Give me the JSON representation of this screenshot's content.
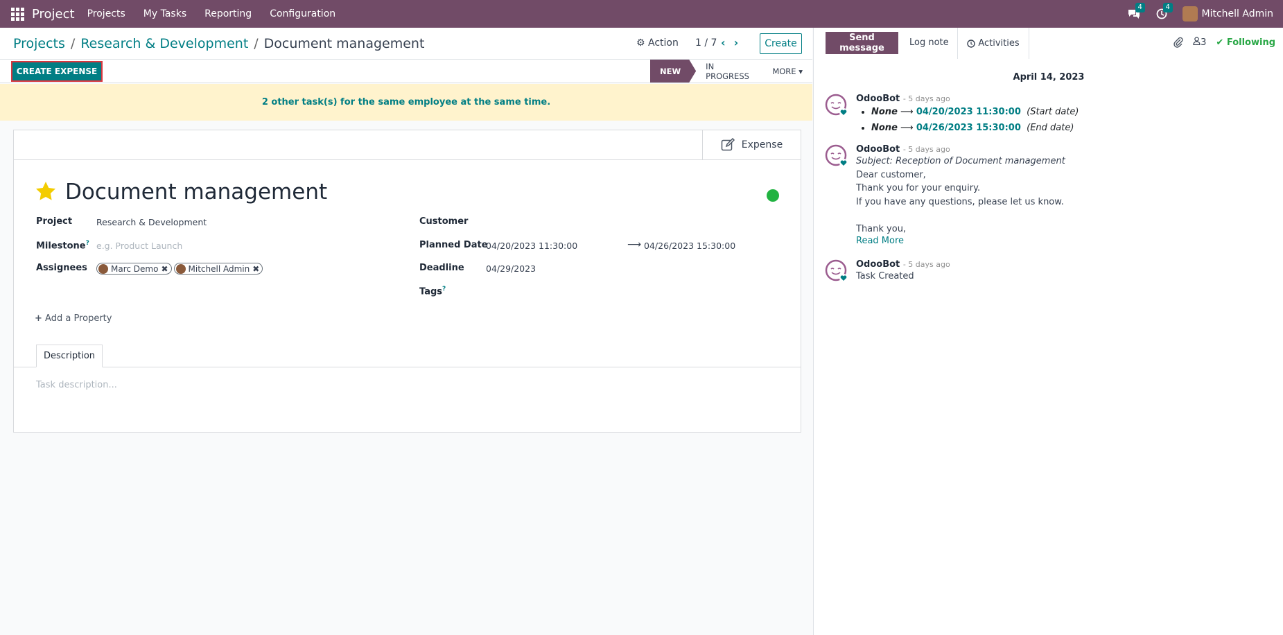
{
  "topbar": {
    "app_name": "Project",
    "menu": [
      "Projects",
      "My Tasks",
      "Reporting",
      "Configuration"
    ],
    "messages_count": "4",
    "activities_count": "4",
    "user_name": "Mitchell Admin"
  },
  "control_panel": {
    "breadcrumb": [
      "Projects",
      "Research & Development",
      "Document management"
    ],
    "action_label": "Action",
    "pager": "1 / 7",
    "create_label": "Create",
    "create_expense_label": "CREATE EXPENSE",
    "stages": [
      {
        "label": "New",
        "active": true
      },
      {
        "label": "In Progress",
        "active": false
      },
      {
        "label": "More",
        "active": false
      }
    ]
  },
  "alert": {
    "text": "2 other task(s) for the same employee at the same time."
  },
  "form": {
    "smart_button_label": "Expense",
    "title": "Document management",
    "labels": {
      "project": "Project",
      "milestone": "Milestone",
      "assignees": "Assignees",
      "customer": "Customer",
      "planned_date": "Planned Date",
      "deadline": "Deadline",
      "tags": "Tags",
      "tooltip_mark": "?"
    },
    "values": {
      "project": "Research & Development",
      "milestone_placeholder": "e.g. Product Launch",
      "assignees": [
        "Marc Demo",
        "Mitchell Admin"
      ],
      "planned_start": "04/20/2023 11:30:00",
      "planned_end": "04/26/2023 15:30:00",
      "deadline": "04/29/2023"
    },
    "add_property_label": "Add a Property",
    "tab_description": "Description",
    "description_placeholder": "Task description..."
  },
  "chatter": {
    "send_message_label": "Send message",
    "log_note_label": "Log note",
    "activities_label": "Activities",
    "followers_count": "3",
    "following_label": "Following",
    "date_separator": "April 14, 2023",
    "messages": [
      {
        "author": "OdooBot",
        "ago": "- 5 days ago",
        "tracking": [
          {
            "old": "None",
            "new": "04/20/2023 11:30:00",
            "field": "(Start date)"
          },
          {
            "old": "None",
            "new": "04/26/2023 15:30:00",
            "field": "(End date)"
          }
        ]
      },
      {
        "author": "OdooBot",
        "ago": "- 5 days ago",
        "subject": "Subject: Reception of Document management",
        "lines": [
          "Dear customer,",
          "Thank you for your enquiry.",
          "If you have any questions, please let us know.",
          "Thank you,"
        ],
        "read_more": "Read More"
      },
      {
        "author": "OdooBot",
        "ago": "- 5 days ago",
        "lines": [
          "Task Created"
        ]
      }
    ]
  },
  "colors": {
    "brand": "#714b67",
    "accent": "#017e84",
    "alert_bg": "#fff3cd",
    "state_green": "#21b341"
  }
}
